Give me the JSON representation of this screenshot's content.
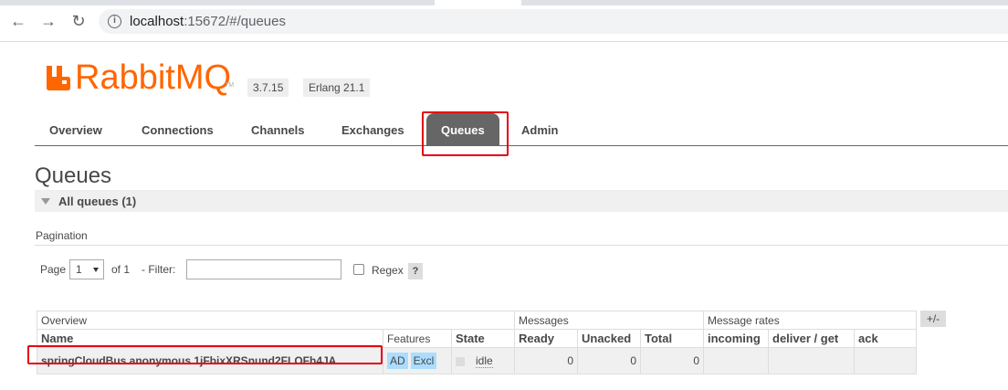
{
  "browser": {
    "url_host": "localhost",
    "url_rest": ":15672/#/queues"
  },
  "logo": {
    "text": "RabbitMQ",
    "tm": "TM"
  },
  "header": {
    "version": "3.7.15",
    "erlang": "Erlang 21.1"
  },
  "tabs": [
    {
      "label": "Overview"
    },
    {
      "label": "Connections"
    },
    {
      "label": "Channels"
    },
    {
      "label": "Exchanges"
    },
    {
      "label": "Queues"
    },
    {
      "label": "Admin"
    }
  ],
  "page": {
    "title": "Queues",
    "section": "All queues (1)"
  },
  "pagination": {
    "label": "Pagination",
    "page_label": "Page",
    "page_value": "1",
    "of_text": "of 1",
    "filter_label": "- Filter:",
    "filter_value": "",
    "regex_label": "Regex",
    "help": "?"
  },
  "table": {
    "groups": {
      "overview": "Overview",
      "messages": "Messages",
      "rates": "Message rates"
    },
    "columns": {
      "name": "Name",
      "features": "Features",
      "state": "State",
      "ready": "Ready",
      "unacked": "Unacked",
      "total": "Total",
      "incoming": "incoming",
      "deliver": "deliver / get",
      "ack": "ack"
    },
    "plus_minus": "+/-",
    "rows": [
      {
        "name": "springCloudBus.anonymous.1jFbixXRSnund2FLOFh4JA",
        "feature_ad": "AD",
        "feature_excl": "Excl",
        "state": "idle",
        "ready": "0",
        "unacked": "0",
        "total": "0"
      }
    ]
  },
  "colors": {
    "brand": "#ff6600",
    "highlight": "#e60012",
    "tab_selected": "#666666",
    "feature_badge": "#aaddff"
  }
}
